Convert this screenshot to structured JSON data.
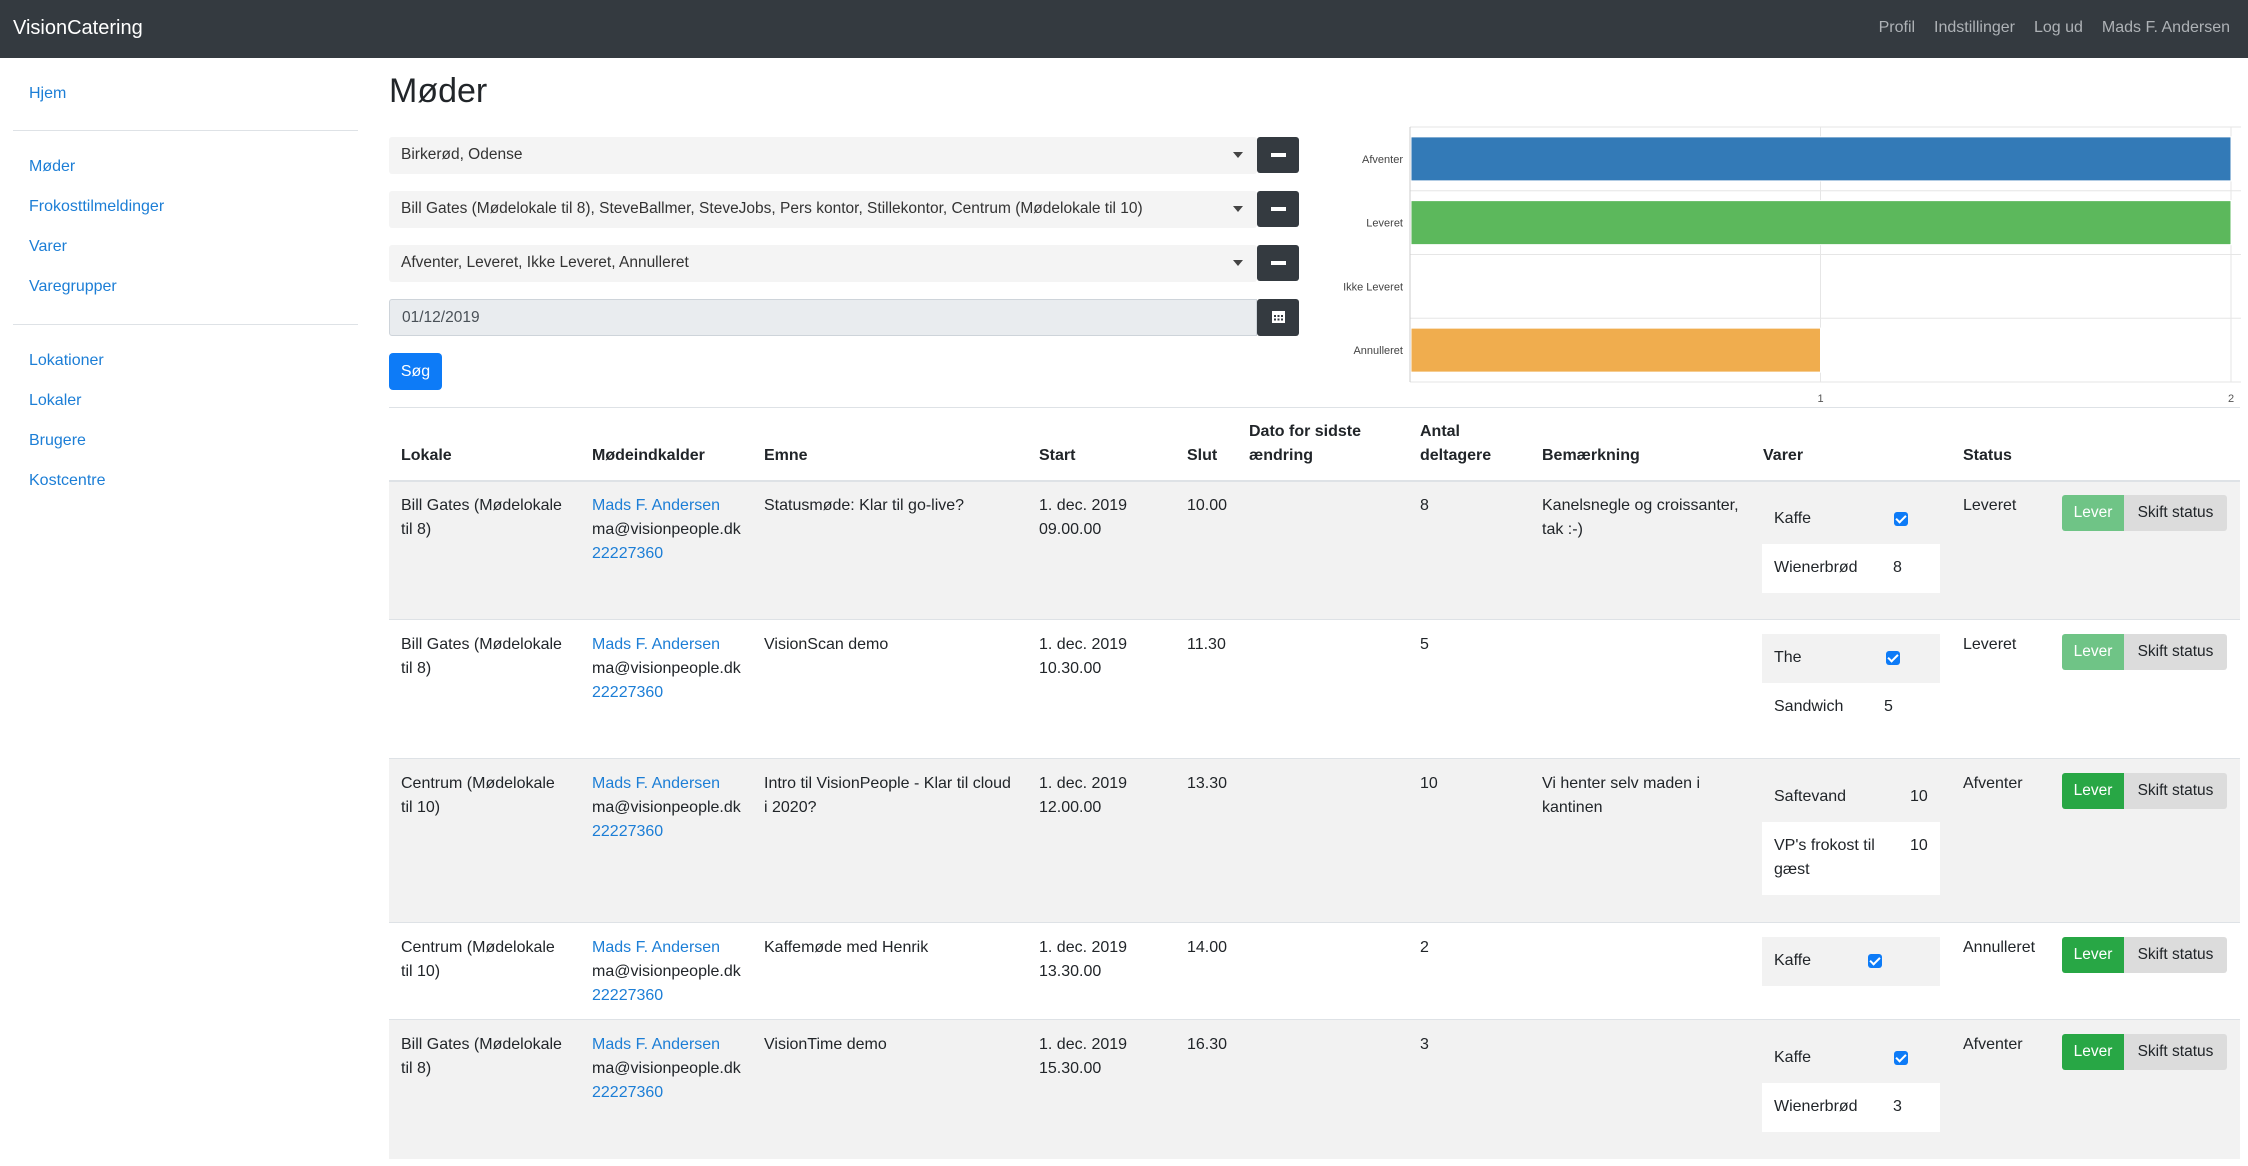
{
  "navbar": {
    "brand": "VisionCatering",
    "links": [
      "Profil",
      "Indstillinger",
      "Log ud",
      "Mads F. Andersen"
    ]
  },
  "sidebar": {
    "group1": [
      "Hjem"
    ],
    "group2": [
      "Møder",
      "Frokosttilmeldinger",
      "Varer",
      "Varegrupper"
    ],
    "group3": [
      "Lokationer",
      "Lokaler",
      "Brugere",
      "Kostcentre"
    ]
  },
  "page": {
    "title": "Møder",
    "filters": {
      "locations": "Birkerød, Odense",
      "rooms": "Bill Gates (Mødelokale til 8), SteveBallmer, SteveJobs, Pers kontor, Stillekontor, Centrum (Mødelokale til 10)",
      "statuses": "Afventer, Leveret, Ikke Leveret, Annulleret",
      "date": "01/12/2019"
    },
    "search_label": "Søg"
  },
  "chart_data": {
    "type": "bar",
    "orientation": "horizontal",
    "categories": [
      "Afventer",
      "Leveret",
      "Ikke Leveret",
      "Annulleret"
    ],
    "values": [
      2,
      2,
      0,
      1
    ],
    "colors": [
      "#337ab7",
      "#5cb85c",
      "#999999",
      "#f0ad4e"
    ],
    "xticks": [
      "1",
      "2"
    ],
    "xlim": [
      0,
      2
    ],
    "grid": true
  },
  "table": {
    "headers": {
      "lokale": "Lokale",
      "modeindkalder": "Mødeindkalder",
      "emne": "Emne",
      "start": "Start",
      "slut": "Slut",
      "dato1": "Dato for sidste",
      "dato2": "ændring",
      "antal1": "Antal",
      "antal2": "deltagere",
      "bemaerkning": "Bemærkning",
      "varer": "Varer",
      "status": "Status"
    },
    "rows": [
      {
        "lokale1": "Bill Gates (Mødelokale",
        "lokale2": "til 8)",
        "name": "Mads F. Andersen",
        "email": "ma@visionpeople.dk",
        "phone": "22227360",
        "emne1": "Statusmøde: Klar til go-live?",
        "emne2": "",
        "start1": "1. dec. 2019",
        "start2": "09.00.00",
        "slut": "10.00",
        "antal": "8",
        "bem1": "Kanelsnegle og croissanter,",
        "bem2": "tak :-)",
        "items": [
          {
            "name": "Kaffe",
            "check": true,
            "qty": ""
          },
          {
            "name": "Wienerbrød",
            "check": false,
            "qty": "8"
          }
        ],
        "status": "Leveret",
        "lever": "Lever",
        "skift": "Skift status"
      },
      {
        "lokale1": "Bill Gates (Mødelokale",
        "lokale2": "til 8)",
        "name": "Mads F. Andersen",
        "email": "ma@visionpeople.dk",
        "phone": "22227360",
        "emne1": "VisionScan demo",
        "emne2": "",
        "start1": "1. dec. 2019",
        "start2": "10.30.00",
        "slut": "11.30",
        "antal": "5",
        "bem1": "",
        "bem2": "",
        "items": [
          {
            "name": "The",
            "check": true,
            "qty": ""
          },
          {
            "name": "Sandwich",
            "check": false,
            "qty": "5"
          }
        ],
        "status": "Leveret",
        "lever": "Lever",
        "skift": "Skift status"
      },
      {
        "lokale1": "Centrum (Mødelokale",
        "lokale2": "til 10)",
        "name": "Mads F. Andersen",
        "email": "ma@visionpeople.dk",
        "phone": "22227360",
        "emne1": "Intro til VisionPeople - Klar til cloud",
        "emne2": "i 2020?",
        "start1": "1. dec. 2019",
        "start2": "12.00.00",
        "slut": "13.30",
        "antal": "10",
        "bem1": "Vi henter selv maden i",
        "bem2": "kantinen",
        "items": [
          {
            "name": "Saftevand",
            "check": false,
            "qty": "10"
          },
          {
            "name": "VP's frokost til",
            "name2": "gæst",
            "check": false,
            "qty": "10"
          }
        ],
        "status": "Afventer",
        "lever": "Lever",
        "skift": "Skift status"
      },
      {
        "lokale1": "Centrum (Mødelokale",
        "lokale2": "til 10)",
        "name": "Mads F. Andersen",
        "email": "ma@visionpeople.dk",
        "phone": "22227360",
        "emne1": "Kaffemøde med Henrik",
        "emne2": "",
        "start1": "1. dec. 2019",
        "start2": "13.30.00",
        "slut": "14.00",
        "antal": "2",
        "bem1": "",
        "bem2": "",
        "items": [
          {
            "name": "Kaffe",
            "check": true,
            "qty": ""
          }
        ],
        "status": "Annulleret",
        "lever": "Lever",
        "skift": "Skift status"
      },
      {
        "lokale1": "Bill Gates (Mødelokale",
        "lokale2": "til 8)",
        "name": "Mads F. Andersen",
        "email": "ma@visionpeople.dk",
        "phone": "22227360",
        "emne1": "VisionTime demo",
        "emne2": "",
        "start1": "1. dec. 2019",
        "start2": "15.30.00",
        "slut": "16.30",
        "antal": "3",
        "bem1": "",
        "bem2": "",
        "items": [
          {
            "name": "Kaffe",
            "check": true,
            "qty": ""
          },
          {
            "name": "Wienerbrød",
            "check": false,
            "qty": "3"
          }
        ],
        "status": "Afventer",
        "lever": "Lever",
        "skift": "Skift status"
      }
    ]
  }
}
